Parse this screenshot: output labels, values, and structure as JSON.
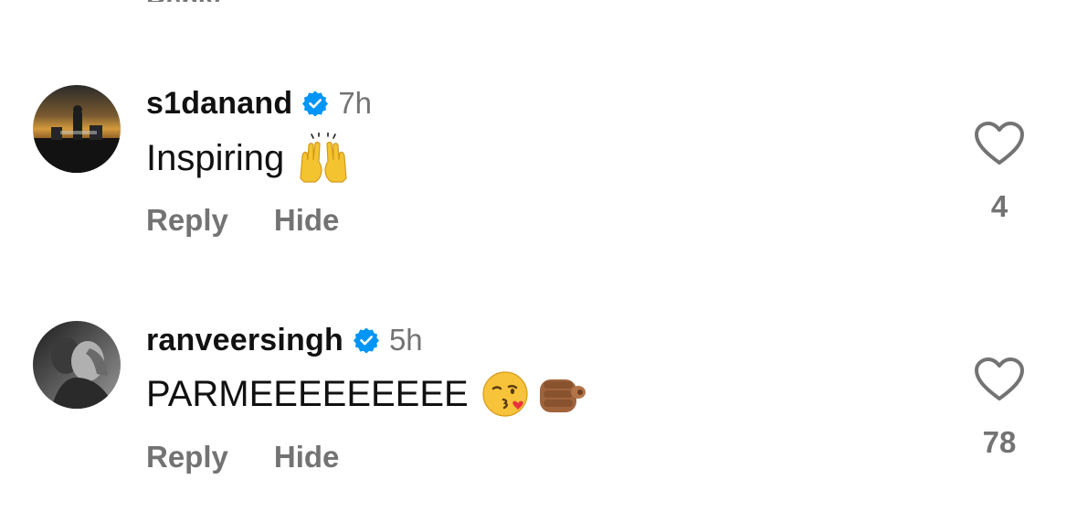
{
  "comments": [
    {
      "username": "s1danand",
      "time": "7h",
      "text": "Inspiring",
      "emojis": [
        "raising-hands-emoji"
      ],
      "reply_label": "Reply",
      "hide_label": "Hide",
      "likes": "4"
    },
    {
      "username": "ranveersingh",
      "time": "5h",
      "text": "PARMEEEEEEEEE",
      "emojis": [
        "face-blowing-kiss-emoji",
        "pointing-at-viewer-emoji"
      ],
      "reply_label": "Reply",
      "hide_label": "Hide",
      "likes": "78"
    }
  ],
  "colors": {
    "verified": "#0095f6",
    "muted_text": "#737373",
    "heart_outline": "#737373"
  }
}
